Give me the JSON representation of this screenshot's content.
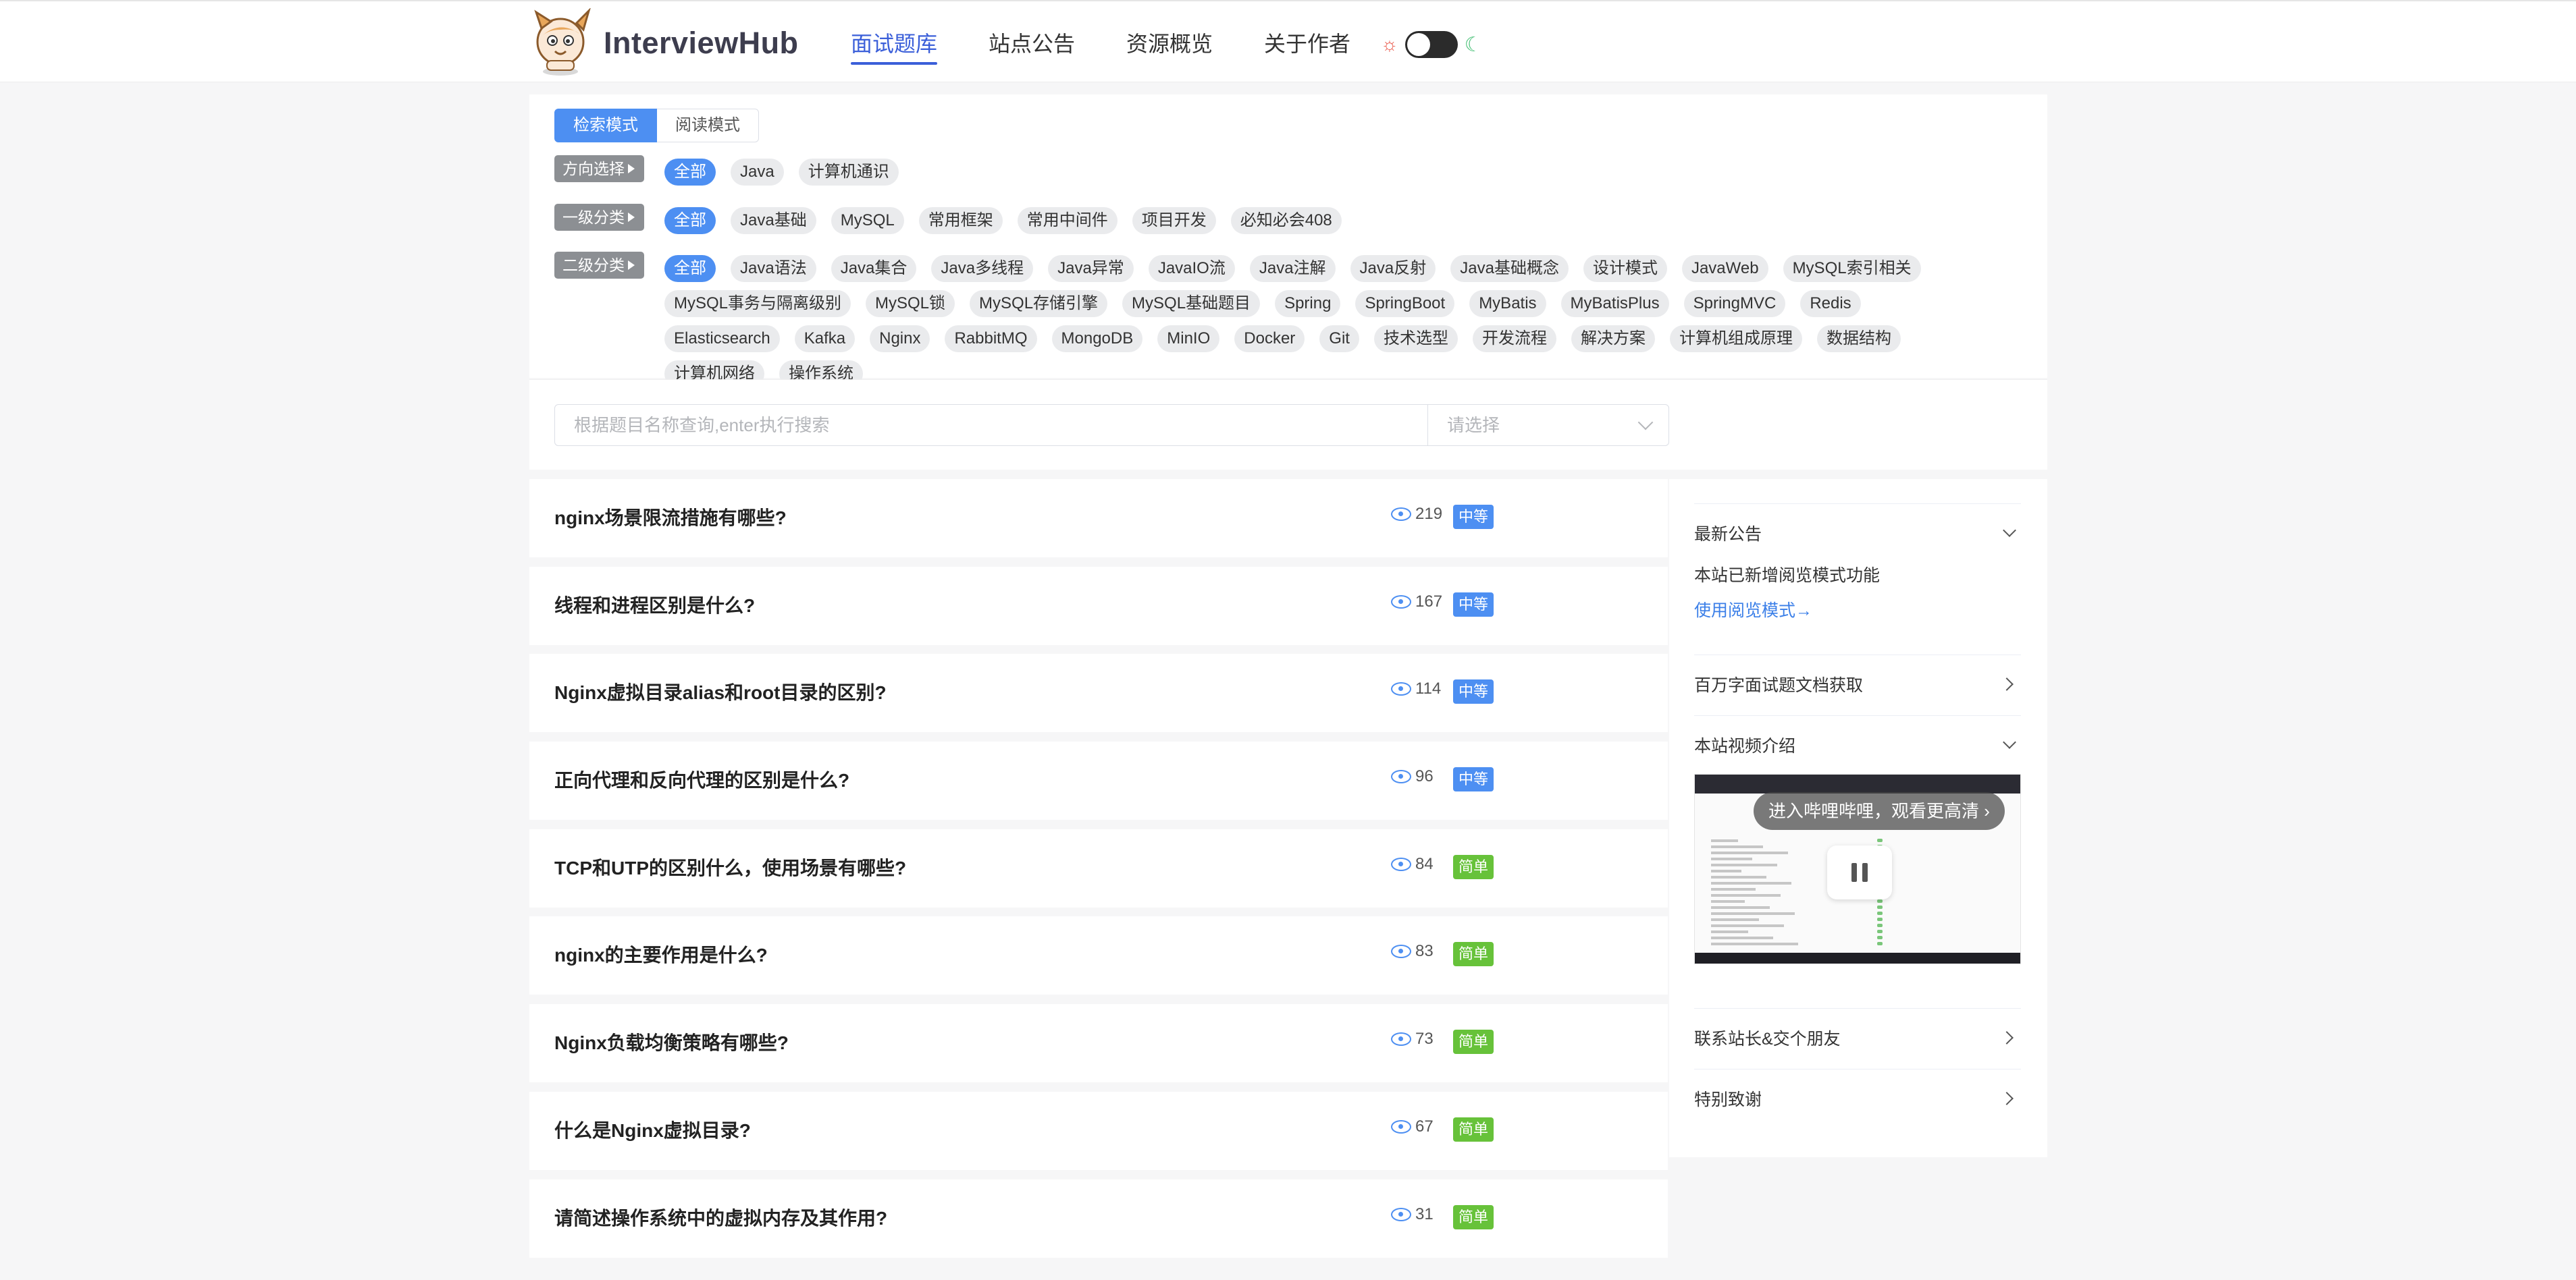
{
  "header": {
    "logo_text": "InterviewHub",
    "nav": [
      {
        "label": "面试题库",
        "active": true
      },
      {
        "label": "站点公告",
        "active": false
      },
      {
        "label": "资源概览",
        "active": false
      },
      {
        "label": "关于作者",
        "active": false
      }
    ],
    "theme_icons": {
      "sun": "sun-icon",
      "moon": "moon-icon"
    }
  },
  "filters": {
    "mode_tabs": [
      "检索模式",
      "阅读模式"
    ],
    "direction": {
      "label": "方向选择",
      "options": [
        "全部",
        "Java",
        "计算机通识"
      ]
    },
    "level1": {
      "label": "一级分类",
      "options": [
        "全部",
        "Java基础",
        "MySQL",
        "常用框架",
        "常用中间件",
        "项目开发",
        "必知必会408"
      ]
    },
    "level2": {
      "label": "二级分类",
      "options": [
        "全部",
        "Java语法",
        "Java集合",
        "Java多线程",
        "Java异常",
        "JavaIO流",
        "Java注解",
        "Java反射",
        "Java基础概念",
        "设计模式",
        "JavaWeb",
        "MySQL索引相关",
        "MySQL事务与隔离级别",
        "MySQL锁",
        "MySQL存储引擎",
        "MySQL基础题目",
        "Spring",
        "SpringBoot",
        "MyBatis",
        "MyBatisPlus",
        "SpringMVC",
        "Redis",
        "Elasticsearch",
        "Kafka",
        "Nginx",
        "RabbitMQ",
        "MongoDB",
        "MinIO",
        "Docker",
        "Git",
        "技术选型",
        "开发流程",
        "解决方案",
        "计算机组成原理",
        "数据结构",
        "计算机网络",
        "操作系统"
      ]
    }
  },
  "search": {
    "placeholder": "根据题目名称查询,enter执行搜索",
    "select_placeholder": "请选择"
  },
  "questions": [
    {
      "title": "nginx场景限流措施有哪些?",
      "views": "219",
      "level": "中等",
      "level_color": "#4d8ff2"
    },
    {
      "title": "线程和进程区别是什么?",
      "views": "167",
      "level": "中等",
      "level_color": "#4d8ff2"
    },
    {
      "title": "Nginx虚拟目录alias和root目录的区别?",
      "views": "114",
      "level": "中等",
      "level_color": "#4d8ff2"
    },
    {
      "title": "正向代理和反向代理的区别是什么?",
      "views": "96",
      "level": "中等",
      "level_color": "#4d8ff2"
    },
    {
      "title": "TCP和UTP的区别什么，使用场景有哪些?",
      "views": "84",
      "level": "简单",
      "level_color": "#67c23a"
    },
    {
      "title": "nginx的主要作用是什么?",
      "views": "83",
      "level": "简单",
      "level_color": "#67c23a"
    },
    {
      "title": "Nginx负载均衡策略有哪些?",
      "views": "73",
      "level": "简单",
      "level_color": "#67c23a"
    },
    {
      "title": "什么是Nginx虚拟目录?",
      "views": "67",
      "level": "简单",
      "level_color": "#67c23a"
    },
    {
      "title": "请简述操作系统中的虚拟内存及其作用?",
      "views": "31",
      "level": "简单",
      "level_color": "#67c23a"
    }
  ],
  "sidebar": {
    "announcement": {
      "title": "最新公告",
      "text": "本站已新增阅览模式功能",
      "link": "使用阅览模式→"
    },
    "doc": {
      "title": "百万字面试题文档获取"
    },
    "video": {
      "title": "本站视频介绍",
      "banner": "进入哔哩哔哩，观看更高清 ›"
    },
    "contact": {
      "title": "联系站长&交个朋友"
    },
    "thanks": {
      "title": "特别致谢"
    }
  }
}
